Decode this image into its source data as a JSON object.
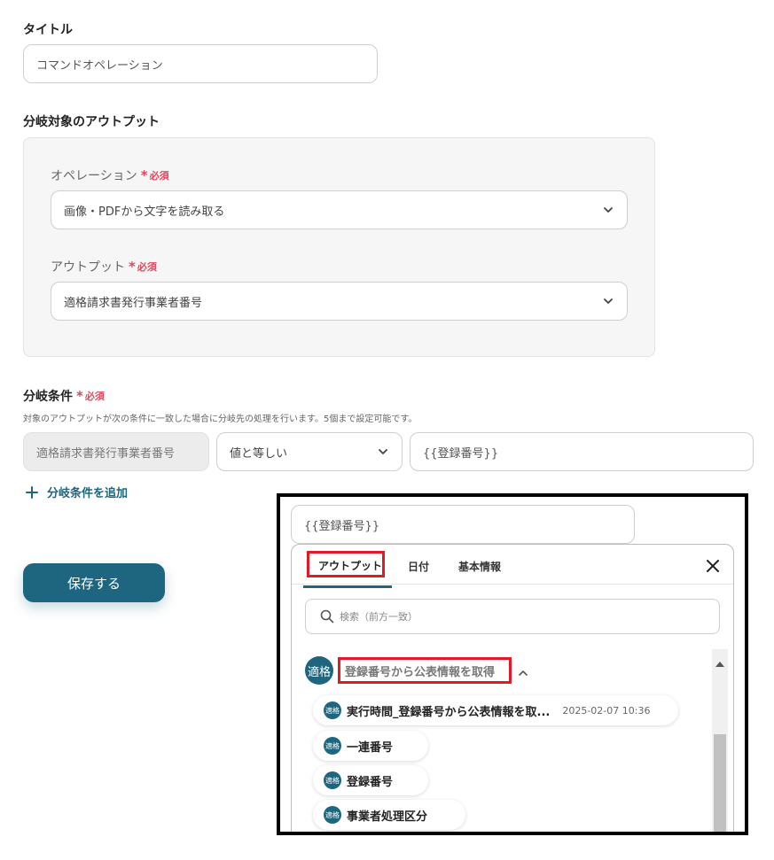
{
  "title_section": {
    "label": "タイトル",
    "value": "コマンドオペレーション"
  },
  "branch_output": {
    "label": "分岐対象のアウトプット",
    "operation": {
      "label": "オペレーション",
      "required_star": "*",
      "required_text": "必須",
      "value": "画像・PDFから文字を読み取る"
    },
    "output": {
      "label": "アウトプット",
      "required_star": "*",
      "required_text": "必須",
      "value": "適格請求書発行事業者番号"
    }
  },
  "branch_condition": {
    "label": "分岐条件",
    "required_star": "*",
    "required_text": "必須",
    "description": "対象のアウトプットが次の条件に一致した場合に分岐先の処理を行います。5個まで設定可能です。",
    "field": "適格請求書発行事業者番号",
    "operator": "値と等しい",
    "value": "{{登録番号}}",
    "add_label": "分岐条件を追加"
  },
  "save_button": "保存する",
  "overlay": {
    "input_value": "{{登録番号}}",
    "tabs": [
      {
        "label": "アウトプット"
      },
      {
        "label": "日付"
      },
      {
        "label": "基本情報"
      }
    ],
    "search_placeholder": "検索（前方一致）",
    "group": {
      "badge": "適格",
      "label": "登録番号から公表情報を取得"
    },
    "items": [
      {
        "badge": "適格",
        "label": "実行時間_登録番号から公表情報を取...",
        "meta": "2025-02-07 10:36"
      },
      {
        "badge": "適格",
        "label": "一連番号"
      },
      {
        "badge": "適格",
        "label": "登録番号"
      },
      {
        "badge": "適格",
        "label": "事業者処理区分"
      }
    ]
  },
  "colors": {
    "accent": "#1e6680",
    "required": "#e0475e",
    "highlight": "#e01b24"
  }
}
